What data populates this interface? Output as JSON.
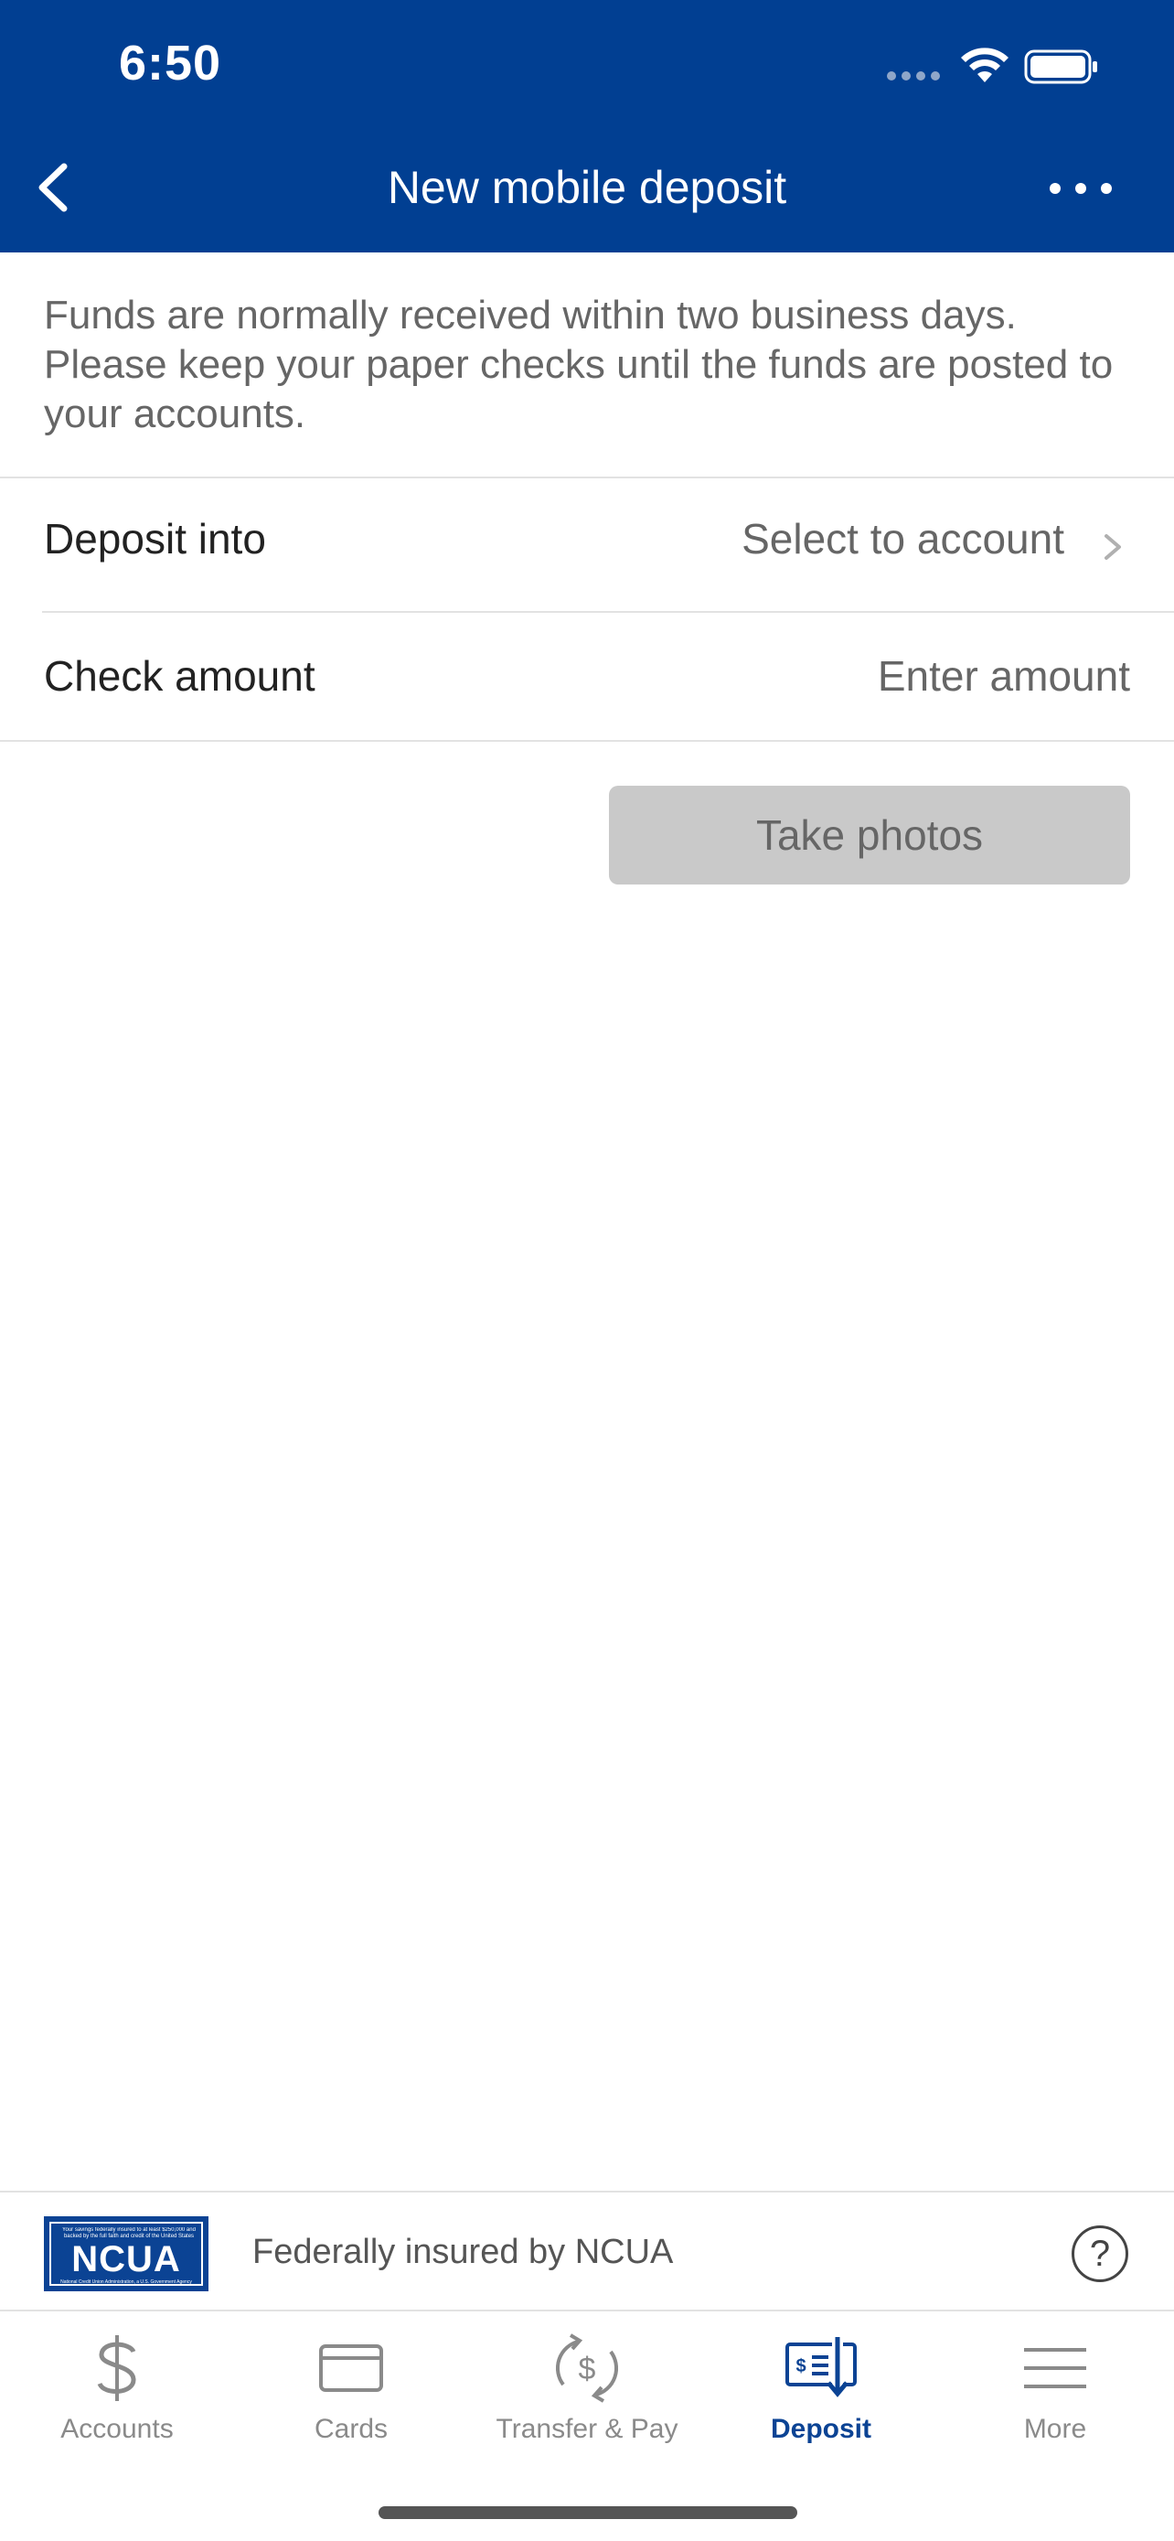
{
  "status_bar": {
    "time": "6:50"
  },
  "header": {
    "title": "New mobile deposit"
  },
  "info_text": "Funds are normally received within two business days. Please keep your paper checks until the funds are posted to your accounts.",
  "deposit_into": {
    "label": "Deposit into",
    "value": "Select to account"
  },
  "check_amount": {
    "label": "Check amount",
    "placeholder": "Enter amount"
  },
  "take_photos_label": "Take photos",
  "ncua": {
    "logo_text": "NCUA",
    "logo_small": "Your savings federally insured to at least $250,000 and backed by the full faith and credit of the United States Government",
    "logo_agency": "National Credit Union Administration, a U.S. Government Agency",
    "label": "Federally insured by NCUA",
    "help_glyph": "?"
  },
  "tabs": [
    {
      "label": "Accounts",
      "icon": "dollar-icon",
      "active": false
    },
    {
      "label": "Cards",
      "icon": "card-icon",
      "active": false
    },
    {
      "label": "Transfer & Pay",
      "icon": "transfer-icon",
      "active": false
    },
    {
      "label": "Deposit",
      "icon": "check-deposit-icon",
      "active": true
    },
    {
      "label": "More",
      "icon": "menu-icon",
      "active": false
    }
  ],
  "colors": {
    "brand": "#013f92",
    "active_tab": "#0b4394",
    "disabled_button": "#c9c9c9"
  }
}
